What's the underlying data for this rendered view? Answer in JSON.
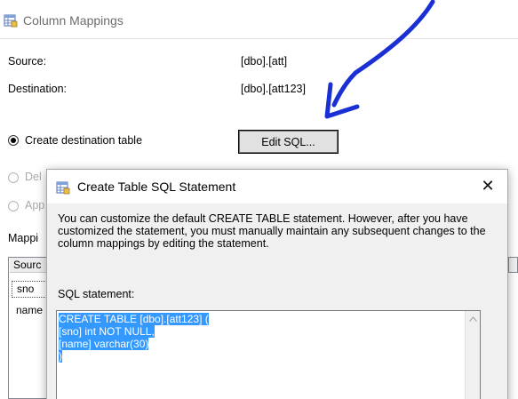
{
  "background_dialog": {
    "title": "Column Mappings",
    "source_label": "Source:",
    "source_value": "[dbo].[att]",
    "destination_label": "Destination:",
    "destination_value": "[dbo].[att123]",
    "options": [
      {
        "label": "Create destination table",
        "checked": true,
        "enabled": true
      },
      {
        "label": "Del",
        "checked": false,
        "enabled": false
      },
      {
        "label": "App",
        "checked": false,
        "enabled": false
      }
    ],
    "edit_sql_button": "Edit SQL...",
    "mappings_label": "Mappi",
    "grid": {
      "header": "Sourc",
      "rows": [
        "sno",
        "name"
      ]
    }
  },
  "modal": {
    "title": "Create Table SQL Statement",
    "close_glyph": "✕",
    "description": "You can customize the default CREATE TABLE statement. However, after you have customized the statement, you must manually maintain any subsequent changes to the column mappings by editing the statement.",
    "sql_label": "SQL statement:",
    "sql_lines": [
      "CREATE TABLE [dbo].[att123] (",
      "[sno] int NOT NULL,",
      "[name] varchar(30)",
      ")"
    ]
  },
  "icons": {
    "title_icon": "table-icon",
    "modal_icon": "table-icon",
    "close": "close-icon",
    "annotation": "hand-drawn-arrow"
  },
  "colors": {
    "selection": "#3399ff",
    "annotation_arrow": "#1a2fd4"
  }
}
